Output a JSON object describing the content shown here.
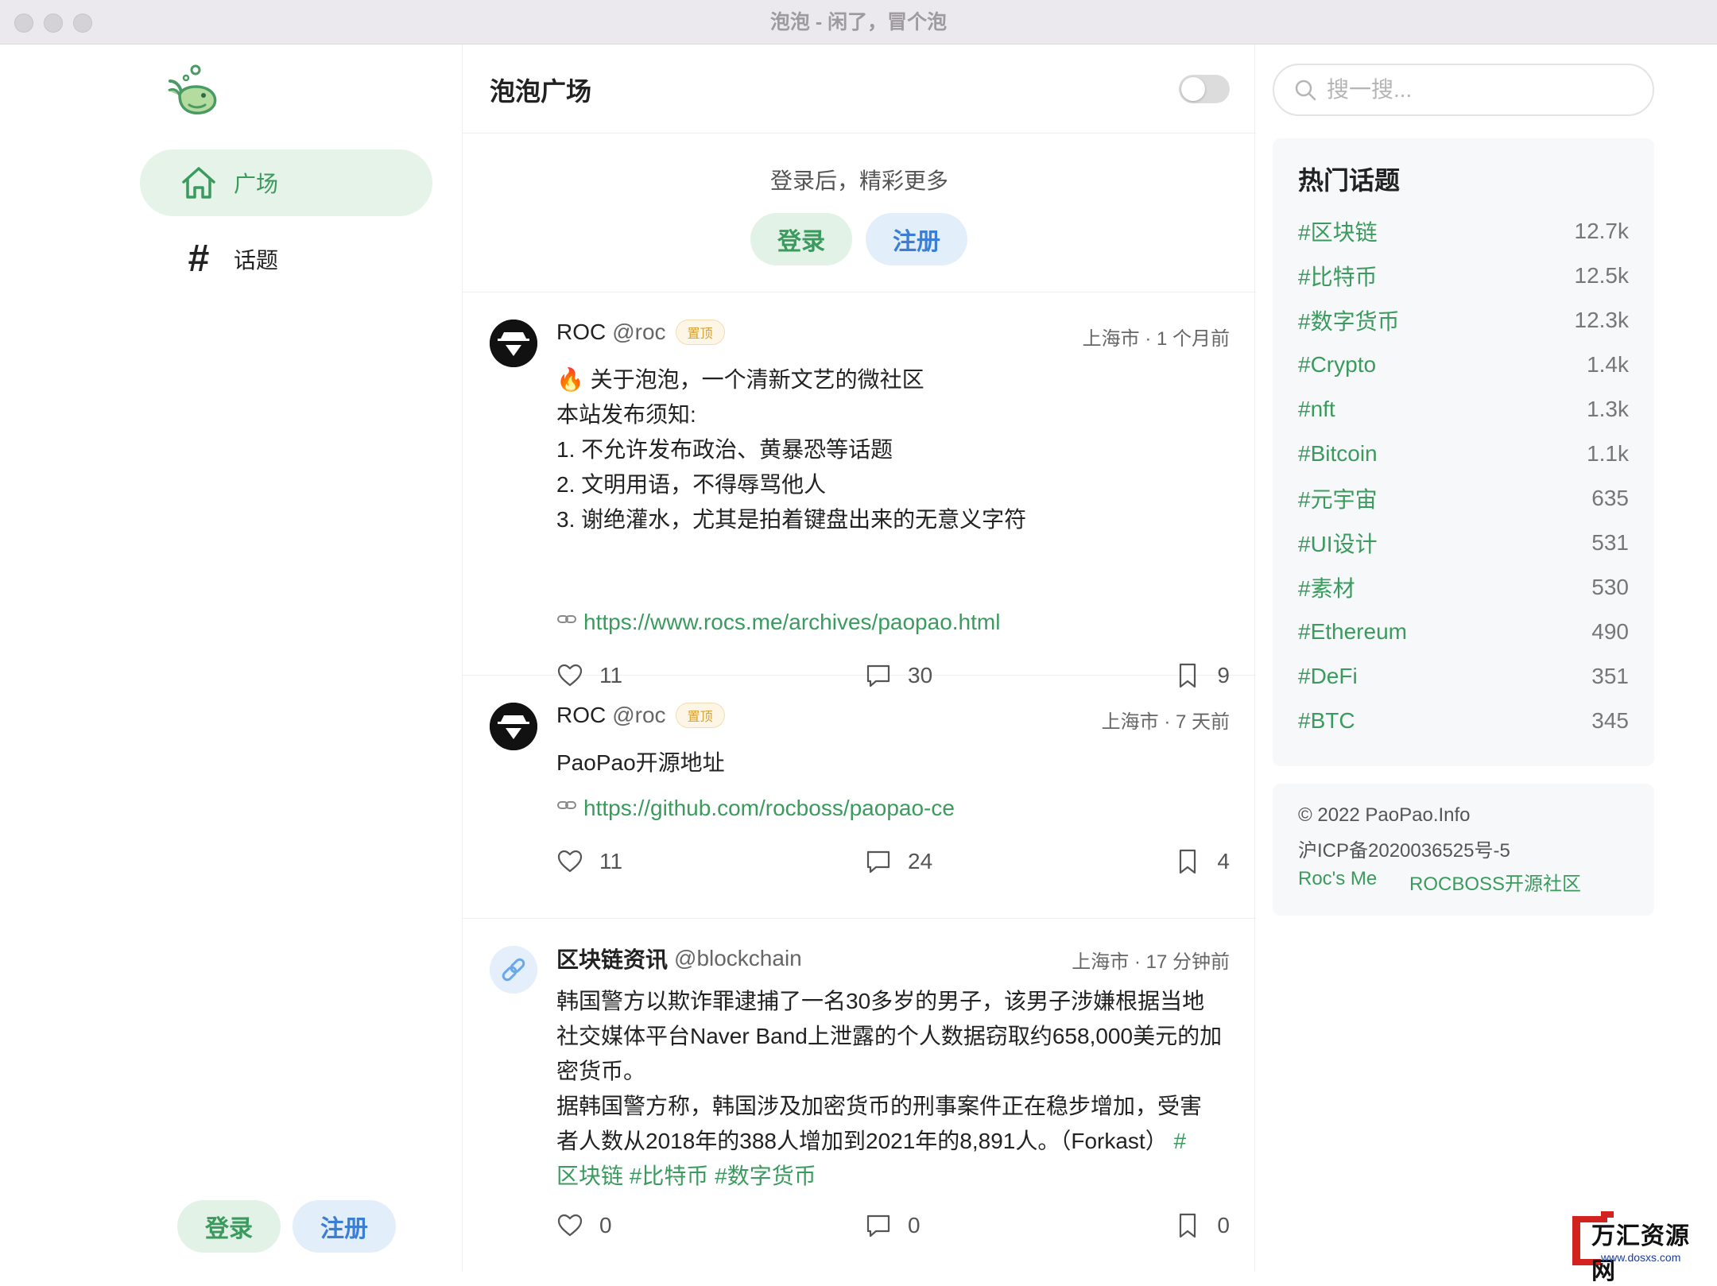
{
  "window": {
    "title": "泡泡 - 闲了，冒个泡"
  },
  "sidebar": {
    "nav": [
      {
        "label": "广场",
        "icon": "home-icon",
        "active": true
      },
      {
        "label": "话题",
        "icon": "hash-icon",
        "glyph": "#",
        "active": false
      }
    ],
    "login_label": "登录",
    "register_label": "注册"
  },
  "center": {
    "title": "泡泡广场",
    "toggle_on": false,
    "login_prompt": "登录后，精彩更多",
    "login_label": "登录",
    "register_label": "注册",
    "posts": [
      {
        "name": "ROC",
        "handle": "@roc",
        "badge": "置顶",
        "meta": "上海市 · 1 个月前",
        "lines": [
          "🔥 关于泡泡，一个清新文艺的微社区",
          "本站发布须知:",
          "1. 不允许发布政治、黄暴恐等话题",
          "2. 文明用语，不得辱骂他人",
          "3. 谢绝灌水，尤其是拍着键盘出来的无意义字符"
        ],
        "link": "https://www.rocs.me/archives/paopao.html",
        "likes": "11",
        "comments": "30",
        "collects": "9"
      },
      {
        "name": "ROC",
        "handle": "@roc",
        "badge": "置顶",
        "meta": "上海市 · 7 天前",
        "lines": [
          "PaoPao开源地址"
        ],
        "link": "https://github.com/rocboss/paopao-ce",
        "likes": "11",
        "comments": "24",
        "collects": "4"
      },
      {
        "name": "区块链资讯",
        "handle": "@blockchain",
        "meta": "上海市 · 17 分钟前",
        "lines": [
          "韩国警方以欺诈罪逮捕了一名30多岁的男子，该男子涉嫌根据当地",
          "社交媒体平台Naver Band上泄露的个人数据窃取约658,000美元的加",
          "密货币。",
          "据韩国警方称，韩国涉及加密货币的刑事案件正在稳步增加，受害",
          "者人数从2018年的388人增加到2021年的8,891人。（Forkast）"
        ],
        "tag_tail": "#",
        "tags_line": "区块链 #比特币 #数字货币",
        "likes": "0",
        "comments": "0",
        "collects": "0"
      }
    ]
  },
  "right": {
    "search_placeholder": "搜一搜...",
    "hot_title": "热门话题",
    "topics": [
      {
        "name": "#区块链",
        "count": "12.7k"
      },
      {
        "name": "#比特币",
        "count": "12.5k"
      },
      {
        "name": "#数字货币",
        "count": "12.3k"
      },
      {
        "name": "#Crypto",
        "count": "1.4k"
      },
      {
        "name": "#nft",
        "count": "1.3k"
      },
      {
        "name": "#Bitcoin",
        "count": "1.1k"
      },
      {
        "name": "#元宇宙",
        "count": "635"
      },
      {
        "name": "#UI设计",
        "count": "531"
      },
      {
        "name": "#素材",
        "count": "530"
      },
      {
        "name": "#Ethereum",
        "count": "490"
      },
      {
        "name": "#DeFi",
        "count": "351"
      },
      {
        "name": "#BTC",
        "count": "345"
      }
    ],
    "footer": {
      "copyright": "© 2022 PaoPao.Info",
      "icp": "沪ICP备2020036525号-5",
      "link1": "Roc's Me",
      "link2": "ROCBOSS开源社区"
    }
  },
  "watermark": {
    "text": "万汇资源网",
    "sub": "www.dosxs.com"
  },
  "colors": {
    "accent_green": "#3b9a5e",
    "accent_blue": "#3a7fd5",
    "pin_badge": "#d7a033"
  }
}
